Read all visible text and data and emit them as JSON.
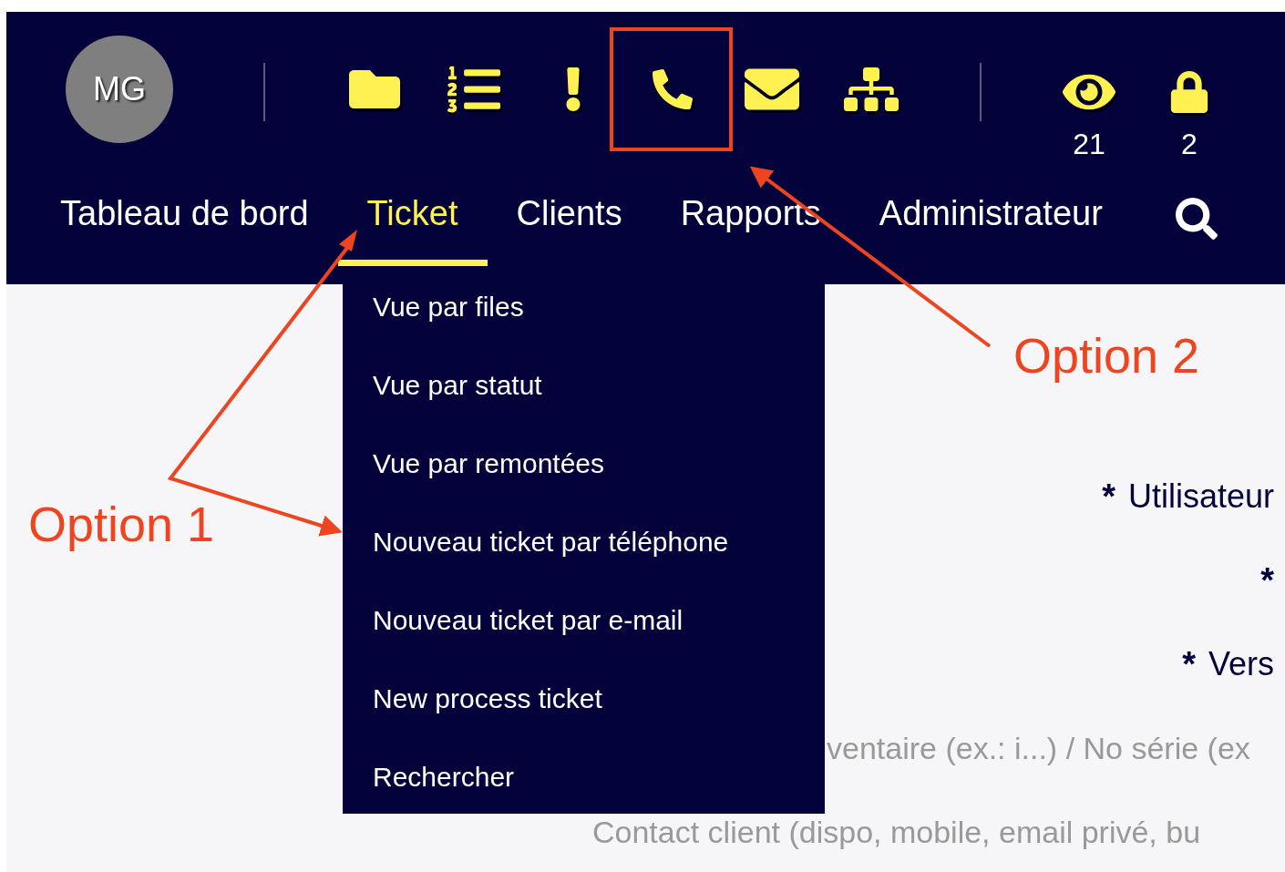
{
  "user": {
    "initials": "MG"
  },
  "toolbar": [
    {
      "kind": "folder"
    },
    {
      "kind": "numbered-list"
    },
    {
      "kind": "exclamation"
    },
    {
      "kind": "phone"
    },
    {
      "kind": "envelope"
    },
    {
      "kind": "sitemap"
    }
  ],
  "counters": [
    {
      "kind": "eye",
      "count": "21"
    },
    {
      "kind": "lock",
      "count": "2"
    }
  ],
  "nav": [
    {
      "label": "Tableau de bord",
      "selected": false
    },
    {
      "label": "Ticket",
      "selected": true
    },
    {
      "label": "Clients",
      "selected": false
    },
    {
      "label": "Rapports",
      "selected": false
    },
    {
      "label": "Administrateur",
      "selected": false
    }
  ],
  "menu": [
    "Vue par files",
    "Vue par statut",
    "Vue par remontées",
    "Nouveau ticket par téléphone",
    "Nouveau ticket par e-mail",
    "New process ticket",
    "Rechercher"
  ],
  "form": {
    "fields": [
      {
        "marker": "*",
        "label": "Utilisateur"
      },
      {
        "marker": "*"
      },
      {
        "marker": "*",
        "label": "Vers"
      }
    ],
    "hints": [
      {
        "placeholder": "ventaire (ex.: i...) / No série (ex"
      },
      {
        "placeholder": "Contact client (dispo, mobile, email privé, bu"
      }
    ]
  },
  "annotations": {
    "option_1": "Option 1",
    "option_2": "Option 2"
  }
}
